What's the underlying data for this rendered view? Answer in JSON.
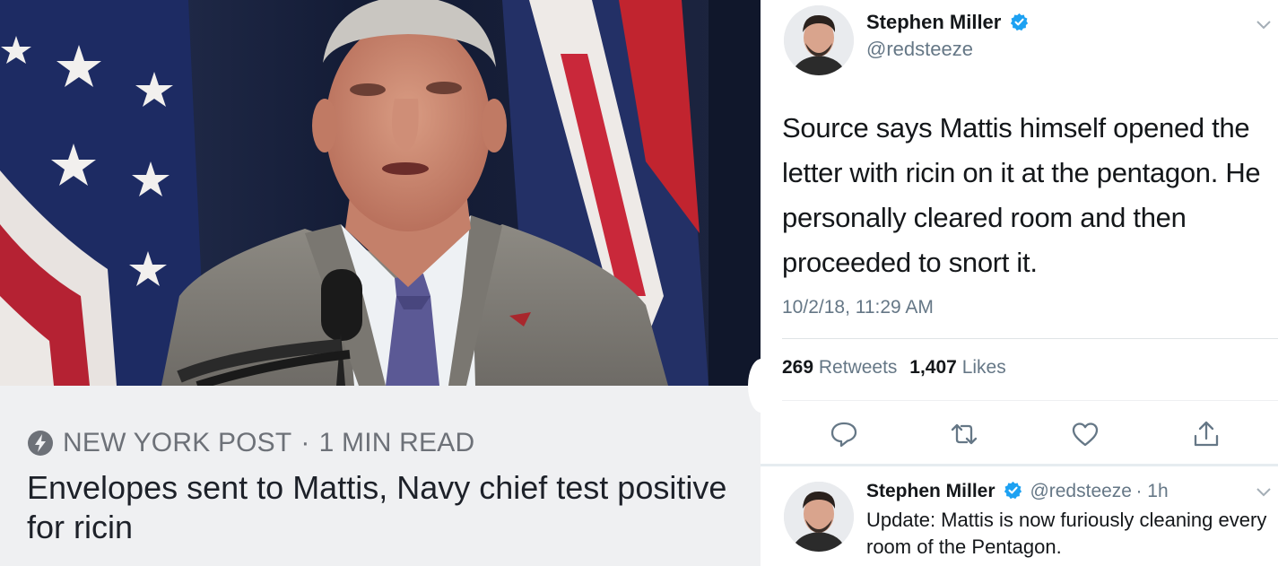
{
  "news": {
    "source": "NEW YORK POST",
    "separator": "·",
    "read_time": "1 MIN READ",
    "headline": "Envelopes sent to Mattis, Navy chief test positive for ricin",
    "meta_icon": "bolt-icon"
  },
  "tweet": {
    "name": "Stephen Miller",
    "handle": "@redsteeze",
    "text": "Source says Mattis himself opened the letter with ricin on it at the pentagon. He personally cleared room and then proceeded to snort it.",
    "timestamp": "10/2/18, 11:29 AM",
    "retweet_count": "269",
    "retweet_label": "Retweets",
    "like_count": "1,407",
    "like_label": "Likes",
    "actions": [
      "reply-icon",
      "retweet-icon",
      "like-icon",
      "share-icon"
    ]
  },
  "reply": {
    "name": "Stephen Miller",
    "handle": "@redsteeze",
    "age": "· 1h",
    "text": "Update: Mattis is now furiously cleaning every room of the Pentagon."
  },
  "colors": {
    "verified": "#1da1f2",
    "secondary_text": "#657786",
    "primary_text": "#14171a",
    "news_background": "#eff0f2"
  }
}
